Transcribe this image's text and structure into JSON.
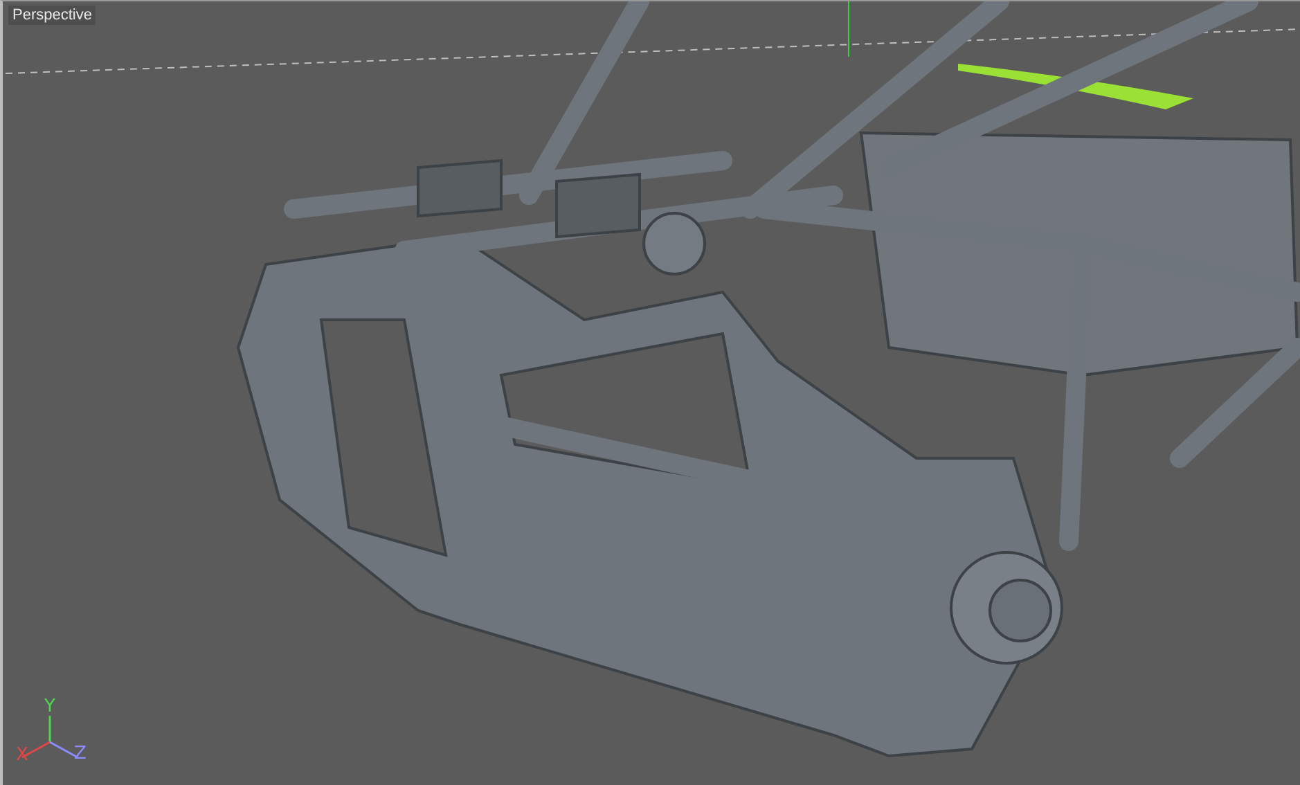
{
  "viewport": {
    "title": "Perspective",
    "axes": [
      {
        "label": "Y",
        "color": "#4fd64f"
      },
      {
        "label": "X",
        "color": "#e04848"
      },
      {
        "label": "Z",
        "color": "#8c8cff"
      }
    ]
  }
}
